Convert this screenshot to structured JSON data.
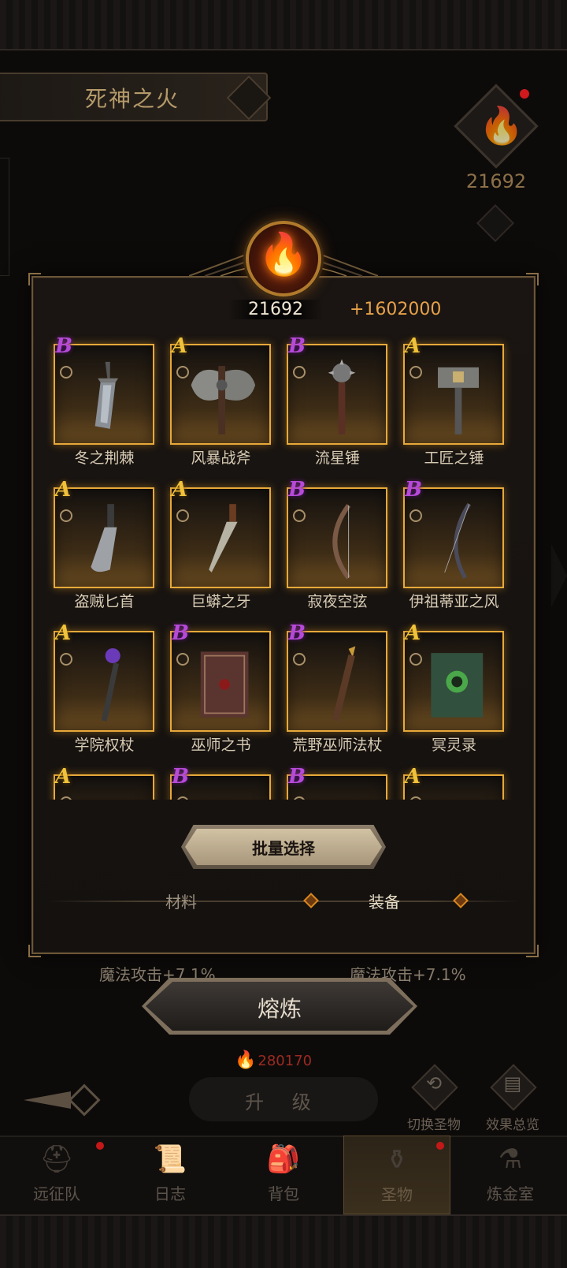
{
  "background": {
    "title": "死神之火",
    "side_counter": "21692",
    "stats_left": "魔法攻击+7.1%",
    "stats_right": "魔法攻击+7.1%",
    "cost": "280170",
    "upgrade_label": "升 级",
    "tools": [
      {
        "label": "切换圣物",
        "icon": "swap-icon"
      },
      {
        "label": "效果总览",
        "icon": "scroll-icon"
      }
    ]
  },
  "modal": {
    "counter_value": "21692",
    "counter_bonus": "+1602000",
    "items": [
      {
        "grade": "B",
        "name": "冬之荆棘",
        "icon": "greatsword-icon"
      },
      {
        "grade": "A",
        "name": "风暴战斧",
        "icon": "battle-axe-icon"
      },
      {
        "grade": "B",
        "name": "流星锤",
        "icon": "morning-star-icon"
      },
      {
        "grade": "A",
        "name": "工匠之锤",
        "icon": "warhammer-icon"
      },
      {
        "grade": "A",
        "name": "盗贼匕首",
        "icon": "dagger-icon"
      },
      {
        "grade": "A",
        "name": "巨蟒之牙",
        "icon": "serrated-blade-icon"
      },
      {
        "grade": "B",
        "name": "寂夜空弦",
        "icon": "bow-icon"
      },
      {
        "grade": "B",
        "name": "伊祖蒂亚之风",
        "icon": "longbow-icon"
      },
      {
        "grade": "A",
        "name": "学院权杖",
        "icon": "orb-staff-icon"
      },
      {
        "grade": "B",
        "name": "巫师之书",
        "icon": "tome-icon"
      },
      {
        "grade": "B",
        "name": "荒野巫师法杖",
        "icon": "wooden-staff-icon"
      },
      {
        "grade": "A",
        "name": "冥灵录",
        "icon": "necro-tome-icon"
      },
      {
        "grade": "A",
        "name": "",
        "icon": "item-icon"
      },
      {
        "grade": "B",
        "name": "",
        "icon": "item-icon"
      },
      {
        "grade": "B",
        "name": "",
        "icon": "item-icon"
      },
      {
        "grade": "A",
        "name": "",
        "icon": "item-icon"
      }
    ],
    "batch_select_label": "批量选择",
    "tabs": [
      {
        "label": "材料",
        "active": false
      },
      {
        "label": "装备",
        "active": true
      }
    ],
    "smelt_label": "熔炼"
  },
  "nav": [
    {
      "label": "远征队",
      "icon": "viking-helmet-icon",
      "badge": true,
      "active": false
    },
    {
      "label": "日志",
      "icon": "scroll-map-icon",
      "badge": false,
      "active": false
    },
    {
      "label": "背包",
      "icon": "backpack-icon",
      "badge": false,
      "active": false
    },
    {
      "label": "圣物",
      "icon": "brazier-icon",
      "badge": true,
      "active": true
    },
    {
      "label": "炼金室",
      "icon": "alchemy-icon",
      "badge": false,
      "active": false
    }
  ],
  "colors": {
    "grade_A": "#f0c23a",
    "grade_B": "#b64ad8",
    "frame_gold": "#e7a93a",
    "bonus_orange": "#e6a24a",
    "cost_red": "#9b2a22"
  }
}
